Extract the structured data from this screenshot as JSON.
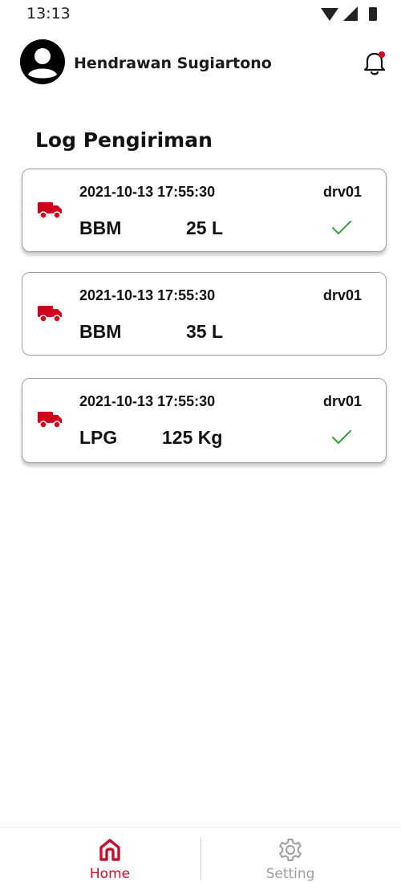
{
  "status_bar": {
    "time": "13:13",
    "icons": [
      "wifi-icon",
      "signal-icon",
      "battery-icon"
    ]
  },
  "header": {
    "user_name": "Hendrawan Sugiartono",
    "avatar_icon": "user-avatar-icon",
    "notification_icon": "bell-icon",
    "notification_dot_color": "#d0021b"
  },
  "section": {
    "title": "Log Pengiriman"
  },
  "logs": [
    {
      "datetime": "2021-10-13 17:55:30",
      "driver": "drv01",
      "type": "BBM",
      "quantity": "25 L",
      "confirmed": true
    },
    {
      "datetime": "2021-10-13 17:55:30",
      "driver": "drv01",
      "type": "BBM",
      "quantity": "35 L",
      "confirmed": false
    },
    {
      "datetime": "2021-10-13 17:55:30",
      "driver": "drv01",
      "type": "LPG",
      "quantity": "125 Kg",
      "confirmed": true
    }
  ],
  "bottom_nav": {
    "items": [
      {
        "label": "Home",
        "icon": "home-icon",
        "active": true
      },
      {
        "label": "Setting",
        "icon": "gear-icon",
        "active": false
      }
    ]
  },
  "colors": {
    "accent": "#c8102e",
    "truck": "#d0021b",
    "check": "#43a047",
    "inactive": "#9e9e9e"
  }
}
